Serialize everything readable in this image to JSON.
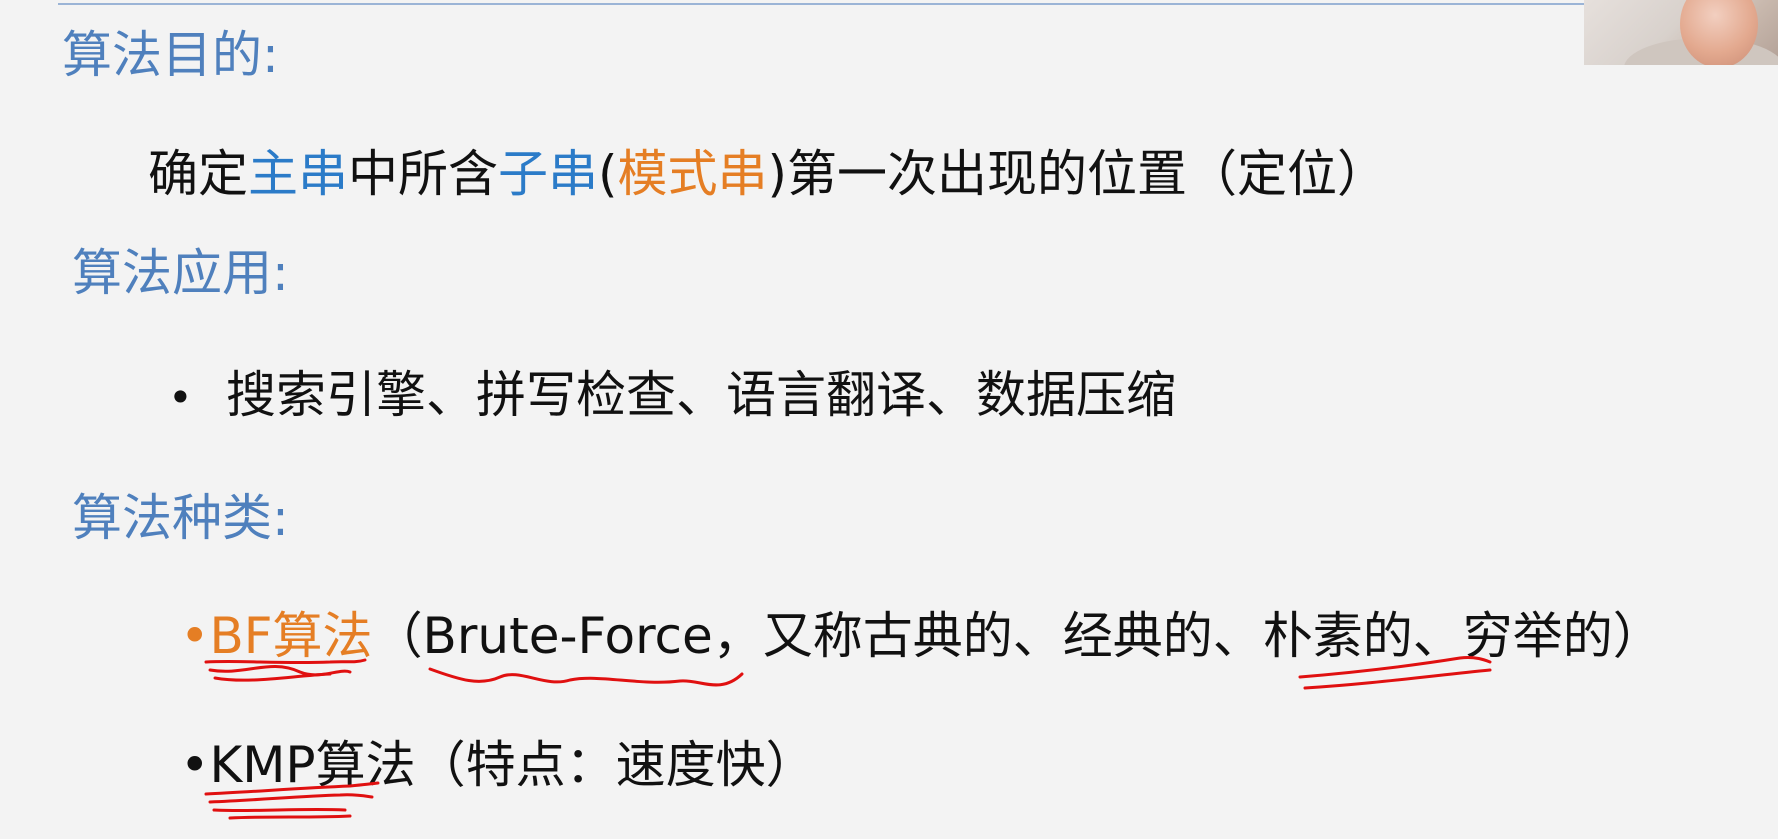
{
  "heading_purpose": "算法目的:",
  "purpose": {
    "p1": "确定",
    "p2": "主串",
    "p3": "中所含",
    "p4": "子串",
    "p5": "(",
    "p6": "模式串",
    "p7": ")第一次出现的位置（定位）"
  },
  "heading_application": "算法应用:",
  "application": {
    "bullet": "•",
    "text": "搜索引擎、拼写检查、语言翻译、数据压缩"
  },
  "heading_types": "算法种类:",
  "bf": {
    "bullet": "•",
    "name": "BF算法",
    "desc": "（Brute-Force，又称古典的、经典的、朴素的、穷举的）"
  },
  "kmp": {
    "bullet": "•",
    "name": "KMP算法",
    "desc": "（特点：速度快）"
  },
  "colors": {
    "heading": "#4f80bd",
    "highlight_blue": "#2b7bc8",
    "highlight_orange": "#e57e24",
    "annotation_ink": "#e01010"
  }
}
